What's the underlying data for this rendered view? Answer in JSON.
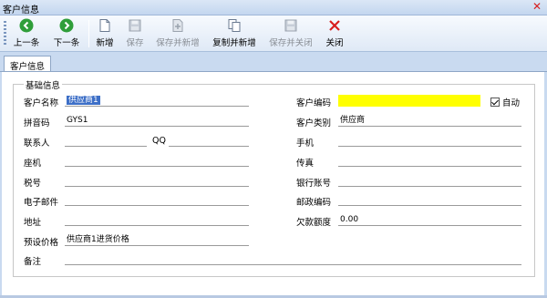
{
  "window": {
    "title": "客户信息",
    "close_glyph": "✕"
  },
  "toolbar": {
    "prev": {
      "label": "上一条",
      "icon": "arrow-left-icon"
    },
    "next": {
      "label": "下一条",
      "icon": "arrow-right-icon"
    },
    "new": {
      "label": "新增",
      "icon": "new-document-icon"
    },
    "save": {
      "label": "保存",
      "icon": "save-icon"
    },
    "save_and_new": {
      "label": "保存并新增",
      "icon": "save-add-icon"
    },
    "copy_and_new": {
      "label": "复制并新增",
      "icon": "copy-icon"
    },
    "save_and_close": {
      "label": "保存并关闭",
      "icon": "save-close-icon"
    },
    "close": {
      "label": "关闭",
      "icon": "close-x-icon"
    },
    "colors": {
      "green": "#2f9e3a",
      "red": "#d81e1e"
    }
  },
  "tabs": [
    {
      "label": "客户信息",
      "active": true
    }
  ],
  "form": {
    "group_title": "基础信息",
    "customer_name": {
      "label": "客户名称",
      "value": "供应商1"
    },
    "customer_code": {
      "label": "客户编码",
      "value": "",
      "highlight": "#ffff00"
    },
    "auto": {
      "label": "自动",
      "checked": true
    },
    "pinyin_code": {
      "label": "拼音码",
      "value": "GYS1"
    },
    "customer_type": {
      "label": "客户类别",
      "value": "供应商"
    },
    "contact": {
      "label": "联系人",
      "value": ""
    },
    "qq": {
      "label": "QQ",
      "value": ""
    },
    "mobile": {
      "label": "手机",
      "value": ""
    },
    "landline": {
      "label": "座机",
      "value": ""
    },
    "fax": {
      "label": "传真",
      "value": ""
    },
    "tax_no": {
      "label": "税号",
      "value": ""
    },
    "bank_account": {
      "label": "银行账号",
      "value": ""
    },
    "email": {
      "label": "电子邮件",
      "value": ""
    },
    "postcode": {
      "label": "邮政编码",
      "value": ""
    },
    "address": {
      "label": "地址",
      "value": ""
    },
    "credit_limit": {
      "label": "欠款额度",
      "value": "0.00"
    },
    "preset_price": {
      "label": "预设价格",
      "value": "供应商1进货价格"
    },
    "remark": {
      "label": "备注",
      "value": ""
    }
  }
}
